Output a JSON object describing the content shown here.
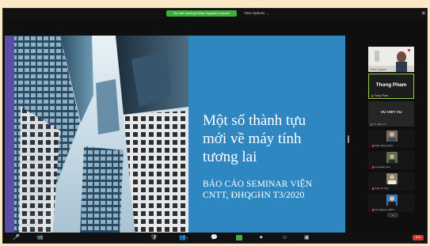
{
  "topbar": {
    "share_notice": "You are viewing Khiêm Nguyen's screen",
    "view_options": "View Options",
    "view_options_chevron": "⌄",
    "window_control": "⊞"
  },
  "slide": {
    "title_line1": "Một số thành tựu",
    "title_line2": "mới về máy tính",
    "title_line3": "tương lai",
    "sub_line1": "BÁO CÁO SEMINAR VIỆN",
    "sub_line2": "CNTT, ĐHQGHN T3/2020"
  },
  "participants": {
    "top_tile_name": "Khiêm Nguyen",
    "active_big": "Thong Pham",
    "active_small": "Thong Pham",
    "gray_big": "VU VIET VU",
    "gray_small": "VU VIET VU",
    "thumbs": [
      {
        "name": "Phan Dang Khoa",
        "color": "#7c6a5c"
      },
      {
        "name": "Le Hoang Lam",
        "color": "#6a6a5c"
      },
      {
        "name": "Xuan Tu Tran",
        "color": "#8a7f6f"
      },
      {
        "name": "Luu Nguyen AMCT",
        "color": "#2f5f8f"
      }
    ],
    "more_arrow": "⌄"
  },
  "bottombar": {
    "mute": "🎤",
    "video": "📹",
    "security": "🛡",
    "participants": "👥",
    "participants_count": "4",
    "chat": "💬",
    "share": "▲",
    "record": "⏺",
    "reactions": "☺",
    "apps": "▣",
    "end": "End"
  }
}
